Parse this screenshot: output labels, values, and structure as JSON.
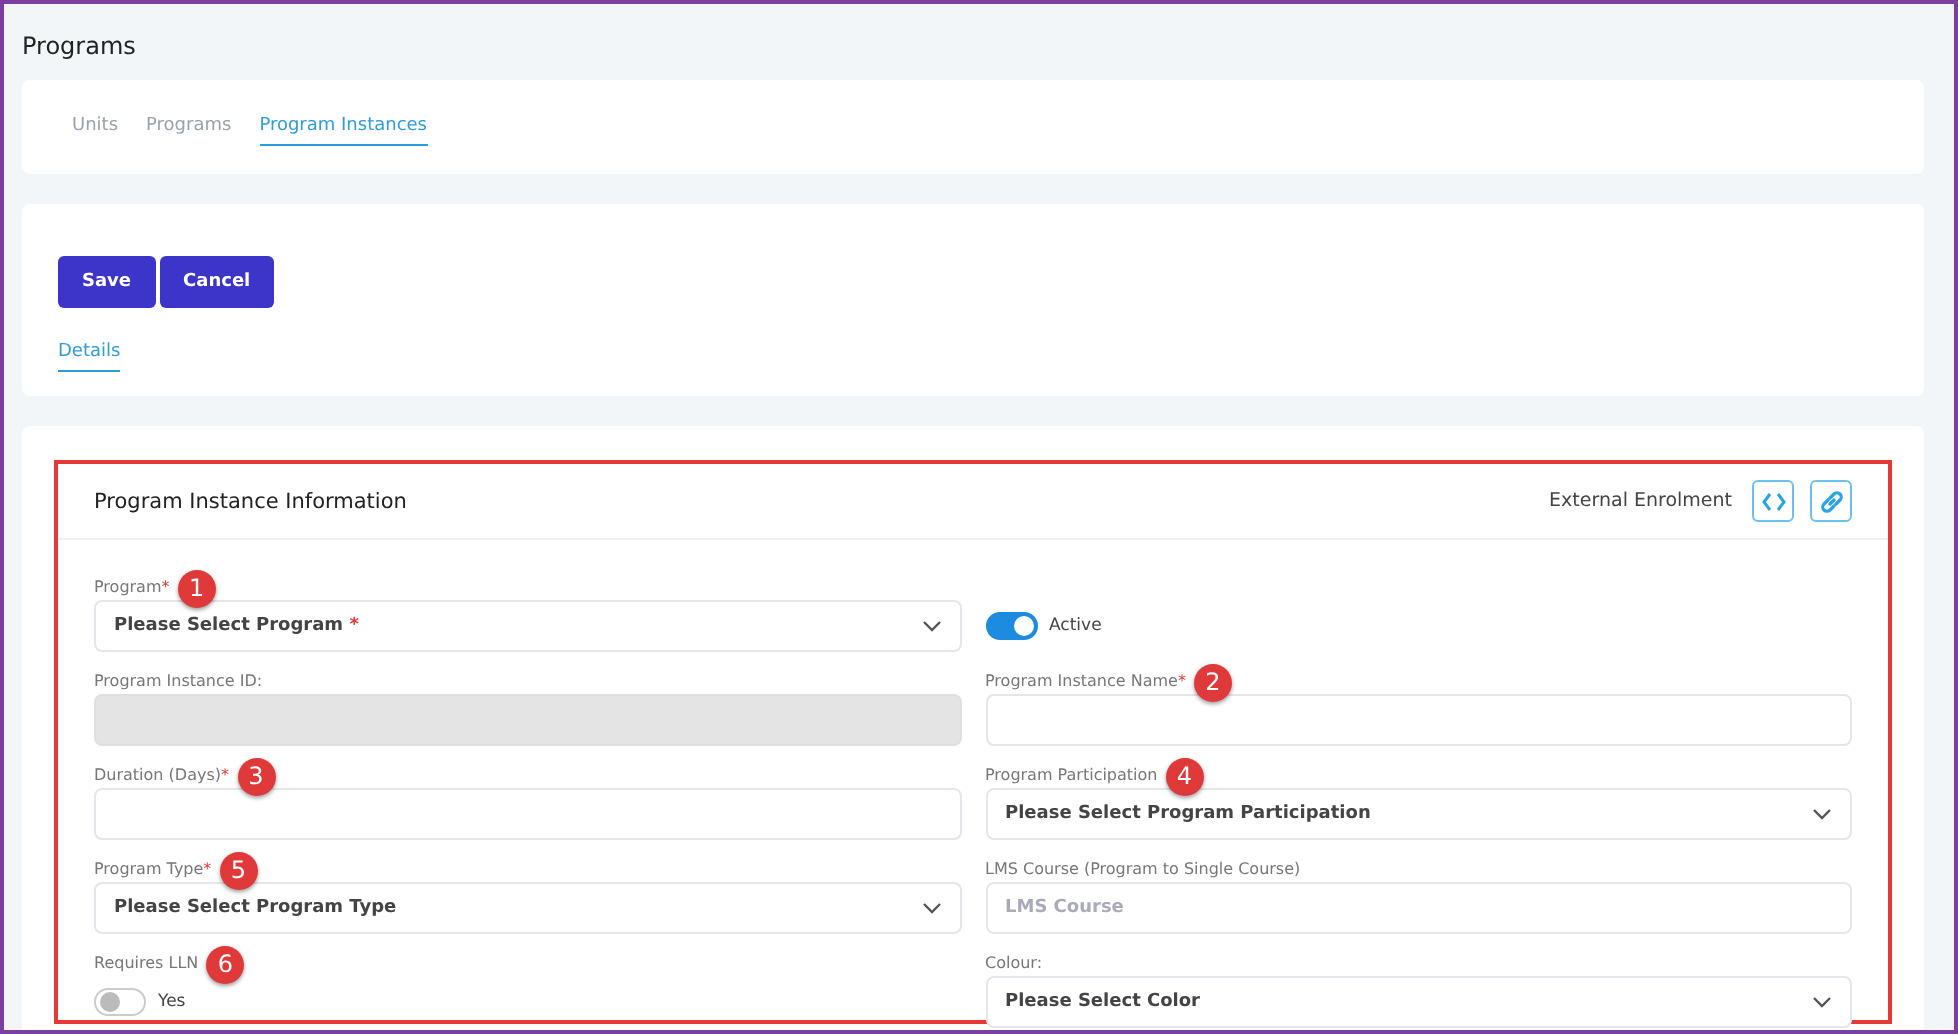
{
  "page_title": "Programs",
  "tabs": [
    {
      "label": "Units",
      "selected": false
    },
    {
      "label": "Programs",
      "selected": false
    },
    {
      "label": "Program Instances",
      "selected": true
    }
  ],
  "actions": [
    {
      "label": "Save"
    },
    {
      "label": "Cancel"
    }
  ],
  "detail_tabs": [
    {
      "label": "Details",
      "selected": true
    }
  ],
  "section": {
    "title": "Program Instance Information",
    "external_label": "External Enrolment",
    "fields": [
      {
        "kind": "select",
        "label": "Program",
        "required_mark": "*",
        "marker": "1",
        "value": "Please Select Program",
        "value_mark": "*"
      },
      {
        "kind": "toggle",
        "on": true,
        "text": "Active"
      },
      {
        "kind": "disabled",
        "label": "Program Instance ID:"
      },
      {
        "kind": "text",
        "label": "Program Instance Name",
        "required_mark": "*",
        "marker": "2"
      },
      {
        "kind": "text",
        "label": "Duration (Days)",
        "required_mark": "*",
        "marker": "3"
      },
      {
        "kind": "select",
        "label": "Program Participation",
        "marker": "4",
        "value": "Please Select Program Participation"
      },
      {
        "kind": "select",
        "label": "Program Type",
        "required_mark": "*",
        "marker": "5",
        "value": "Please Select Program Type"
      },
      {
        "kind": "text",
        "label": "LMS Course (Program to Single Course)",
        "placeholder": "LMS Course"
      },
      {
        "kind": "toggle",
        "label": "Requires LLN",
        "marker": "6",
        "on": false,
        "text": "Yes"
      },
      {
        "kind": "select",
        "label": "Colour:",
        "value": "Please Select Color"
      }
    ]
  }
}
